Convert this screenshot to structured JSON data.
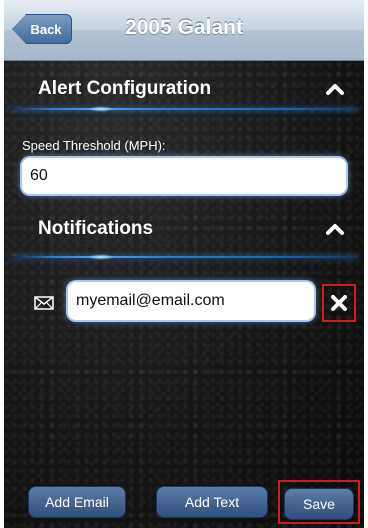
{
  "navbar": {
    "back_label": "Back",
    "title": "2005 Galant"
  },
  "alert_section": {
    "title": "Alert Configuration",
    "expanded": true
  },
  "speed_threshold": {
    "label": "Speed Threshold (MPH):",
    "value": "60"
  },
  "notifications_section": {
    "title": "Notifications",
    "expanded": true
  },
  "email_entry": {
    "value": "myemail@email.com",
    "icon": "envelope-icon",
    "remove_icon": "close-icon"
  },
  "toolbar": {
    "add_email_label": "Add Email",
    "add_text_label": "Add Text",
    "save_label": "Save"
  },
  "colors": {
    "accent_blue": "#2e7bd1",
    "highlight_red": "#d01c1c"
  }
}
